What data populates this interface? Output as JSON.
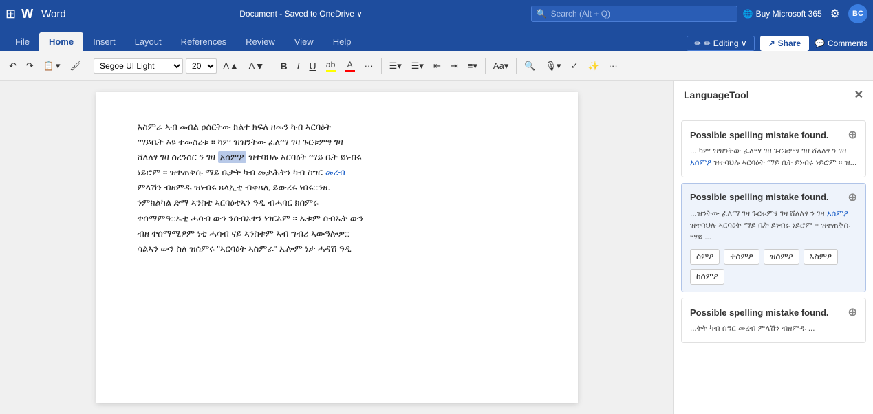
{
  "titleBar": {
    "gridIcon": "⊞",
    "logo": "W",
    "appName": "Word",
    "docTitle": "Document - Saved to OneDrive ∨",
    "search": {
      "placeholder": "Search (Alt + Q)"
    },
    "buyMs": "Buy Microsoft 365",
    "gearIcon": "⚙",
    "avatarText": "BC"
  },
  "ribbonTabs": {
    "tabs": [
      {
        "label": "File",
        "active": false
      },
      {
        "label": "Home",
        "active": true
      },
      {
        "label": "Insert",
        "active": false
      },
      {
        "label": "Layout",
        "active": false
      },
      {
        "label": "References",
        "active": false
      },
      {
        "label": "Review",
        "active": false
      },
      {
        "label": "View",
        "active": false
      },
      {
        "label": "Help",
        "active": false
      }
    ],
    "editingBtn": "✏ Editing ∨",
    "shareBtn": "Share",
    "commentsBtn": "Comments"
  },
  "toolbar": {
    "undoLabel": "↶",
    "redoLabel": "↷",
    "clipboardLabel": "📋",
    "formatPainterLabel": "🖌",
    "fontFamily": "Segoe UI Light",
    "fontSize": "20",
    "increaseFontLabel": "A↑",
    "decreaseFontLabel": "A↓",
    "boldLabel": "B",
    "italicLabel": "I",
    "underlineLabel": "U",
    "highlightLabel": "ab",
    "fontColorLabel": "A",
    "moreLabel": "...",
    "bulletLabel": "≡",
    "numberLabel": "≡",
    "indentDecLabel": "⇤",
    "indentIncLabel": "⇥",
    "alignLabel": "≡",
    "stylesLabel": "Aa",
    "findLabel": "🔍",
    "dictateLabel": "🎙",
    "editorLabel": "✓",
    "rewriteLabel": "✨",
    "moreToolsLabel": "..."
  },
  "document": {
    "content": [
      "አስምራ ኣብ መበል ዐሰርትው ክልተ ክፍለ ዘመን ካብ ኣርባዕት",
      "ማይቤት እዩ ተመስሪቱ ። ካም ዝዝንትው ፈለማ ገዛ ጉርቱምፃ ገዛ",
      "ሸለለፃ ገዛ ሰረንሰር ን ገዛ አሰምዖ ዝተባህሉ ኣርባዕት ማይ ቤት ይነብሩ",
      "ነይሮም ። ዝተጠቅሱ ማይ ቤታት ካብ መታሕትን ካብ ስግር መረብ",
      "ምላሽን ብዘምዱ ዝነብሩ ጸላኢቲ ብቀጻሊ ይውረሩ ነበሩ::ንዘ.",
      "ንምክልካል ድማ ኣንስቲ ኣርባዕቲኣን ዓዲ ብሓባር ክሰምሩ",
      "ተሰማምዓ::ኤቲ ሓሳብ ውን ንሰብኦተን ነገርኣም ። ኤቱም ሰብኤት ውን",
      "ብዘ ተሰማሚዖም ነቲ ሓሳብ ናይ ኣንስቱም ኣብ ግብሪ ኣውዓሎዎ::",
      "ሳልኣን ውን ስለ ዝሰምሩ \"ኣርባዕት ኣስምራ\" ኤሎም ነታ ሓዳሽ ዓዲ"
    ],
    "highlightedWord": "አሰምዖ",
    "underlinedWord": "አሰምዖ"
  },
  "sidebar": {
    "title": "LanguageTool",
    "closeIcon": "✕",
    "suggestions": [
      {
        "id": 1,
        "title": "Possible spelling mistake found.",
        "active": false,
        "addIcon": "⊕",
        "text": "... ካም ዝዝንትው ፈለማ ገዛ ጉርቱምፃ ገዛ ሸለለፃ ን ገዛ አሰምዖ ዝተባህሉ ኣርባዕት ማይ ቤት ይነብሩ ነይሮም ። ዝ...",
        "options": []
      },
      {
        "id": 2,
        "title": "Possible spelling mistake found.",
        "active": true,
        "addIcon": "⊕",
        "text": "...ዝንትው ፈለማ ገዛ ጉርቱምፃ ገዛ ሸለለፃ ን ገዛ አሰምዖ ዝተባህሉ ኣርባዕት ማይ ቤት ይነብሩ ነይሮም ። ዝተጠቅሱ ማይ ...",
        "underlinedText": "አሰምዖ",
        "options": [
          "ሰምዖ",
          "ተሰምዖ",
          "ዝሰምዖ",
          "ኣስምዖ",
          "ከሰምዖ"
        ]
      },
      {
        "id": 3,
        "title": "Possible spelling mistake found.",
        "active": false,
        "addIcon": "⊕",
        "text": "...ትት ካብ ሰዓር መረብ ምላሽን ብዘምዱ ..."
      }
    ]
  }
}
